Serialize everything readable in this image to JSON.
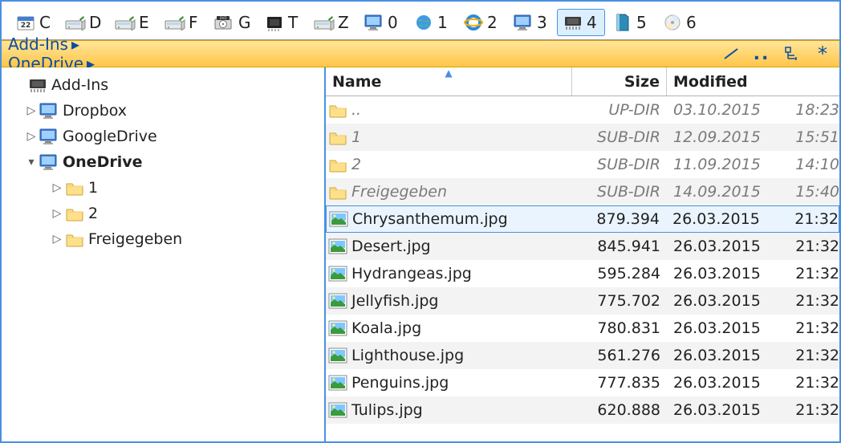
{
  "drives": [
    {
      "id": "c",
      "label": "C",
      "icon": "calendar"
    },
    {
      "id": "d",
      "label": "D",
      "icon": "hdd"
    },
    {
      "id": "e",
      "label": "E",
      "icon": "hdd"
    },
    {
      "id": "f",
      "label": "F",
      "icon": "hdd"
    },
    {
      "id": "g",
      "label": "G",
      "icon": "dvd"
    },
    {
      "id": "t",
      "label": "T",
      "icon": "chip-dark"
    },
    {
      "id": "z",
      "label": "Z",
      "icon": "hdd"
    },
    {
      "id": "0",
      "label": "0",
      "icon": "monitor"
    },
    {
      "id": "1",
      "label": "1",
      "icon": "globe"
    },
    {
      "id": "2",
      "label": "2",
      "icon": "ie"
    },
    {
      "id": "3",
      "label": "3",
      "icon": "monitor"
    },
    {
      "id": "4",
      "label": "4",
      "icon": "chip",
      "selected": true
    },
    {
      "id": "5",
      "label": "5",
      "icon": "book"
    },
    {
      "id": "6",
      "label": "6",
      "icon": "disc"
    }
  ],
  "breadcrumb": {
    "segments": [
      "Add-Ins",
      "OneDrive"
    ],
    "right_tools": [
      "line-icon",
      "dots-icon",
      "tree-icon",
      "star-icon"
    ]
  },
  "tree": [
    {
      "level": 0,
      "expander": "none",
      "icon": "chip",
      "label": "Add-Ins",
      "bold": false
    },
    {
      "level": 1,
      "expander": "closed",
      "icon": "monitor",
      "label": "Dropbox"
    },
    {
      "level": 1,
      "expander": "closed",
      "icon": "monitor",
      "label": "GoogleDrive"
    },
    {
      "level": 1,
      "expander": "open",
      "icon": "monitor",
      "label": "OneDrive",
      "bold": true
    },
    {
      "level": 2,
      "expander": "closed",
      "icon": "folder",
      "label": "1"
    },
    {
      "level": 2,
      "expander": "closed",
      "icon": "folder",
      "label": "2"
    },
    {
      "level": 2,
      "expander": "closed",
      "icon": "folder",
      "label": "Freigegeben"
    }
  ],
  "columns": {
    "name": "Name",
    "size": "Size",
    "modified": "Modified",
    "sort": "name-asc"
  },
  "rows": [
    {
      "type": "updir",
      "name": "..",
      "size": "UP-DIR",
      "date": "03.10.2015",
      "time": "18:23"
    },
    {
      "type": "dir",
      "name": "1",
      "size": "SUB-DIR",
      "date": "12.09.2015",
      "time": "15:51"
    },
    {
      "type": "dir",
      "name": "2",
      "size": "SUB-DIR",
      "date": "11.09.2015",
      "time": "14:10"
    },
    {
      "type": "dir",
      "name": "Freigegeben",
      "size": "SUB-DIR",
      "date": "14.09.2015",
      "time": "15:40"
    },
    {
      "type": "image",
      "name": "Chrysanthemum.jpg",
      "size": "879.394",
      "date": "26.03.2015",
      "time": "21:32",
      "selected": true
    },
    {
      "type": "image",
      "name": "Desert.jpg",
      "size": "845.941",
      "date": "26.03.2015",
      "time": "21:32"
    },
    {
      "type": "image",
      "name": "Hydrangeas.jpg",
      "size": "595.284",
      "date": "26.03.2015",
      "time": "21:32"
    },
    {
      "type": "image",
      "name": "Jellyfish.jpg",
      "size": "775.702",
      "date": "26.03.2015",
      "time": "21:32"
    },
    {
      "type": "image",
      "name": "Koala.jpg",
      "size": "780.831",
      "date": "26.03.2015",
      "time": "21:32"
    },
    {
      "type": "image",
      "name": "Lighthouse.jpg",
      "size": "561.276",
      "date": "26.03.2015",
      "time": "21:32"
    },
    {
      "type": "image",
      "name": "Penguins.jpg",
      "size": "777.835",
      "date": "26.03.2015",
      "time": "21:32"
    },
    {
      "type": "image",
      "name": "Tulips.jpg",
      "size": "620.888",
      "date": "26.03.2015",
      "time": "21:32"
    }
  ]
}
